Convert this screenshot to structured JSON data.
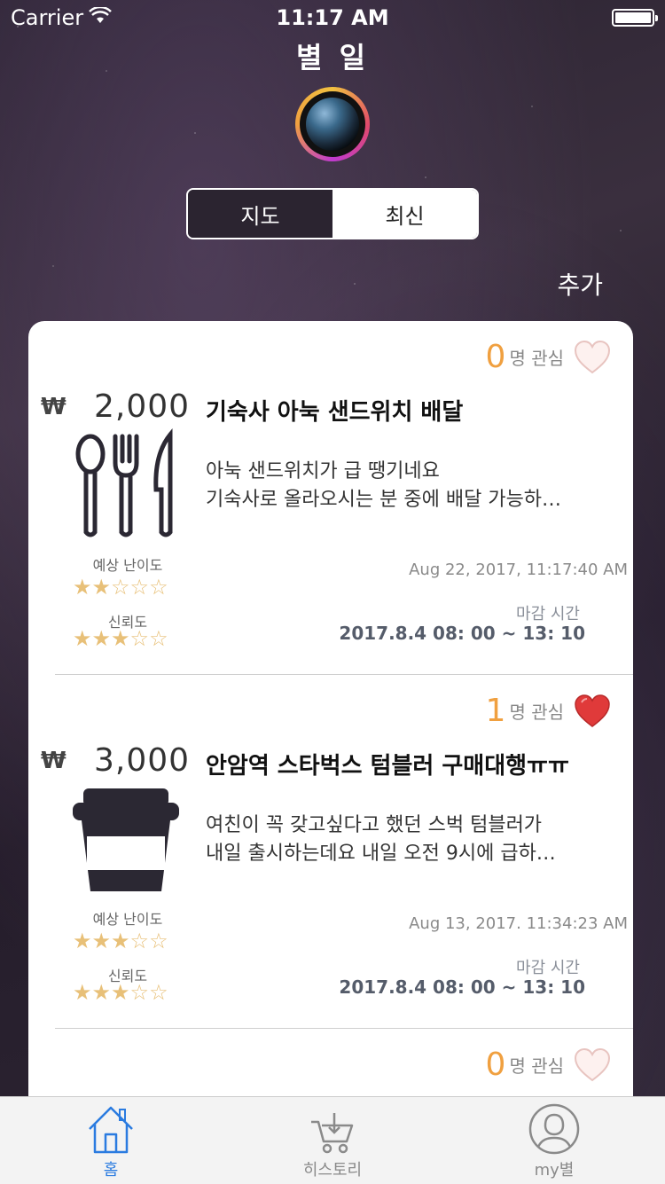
{
  "status": {
    "carrier": "Carrier",
    "time": "11:17 AM"
  },
  "header": {
    "title": "별 일"
  },
  "segment": {
    "map_label": "지도",
    "latest_label": "최신"
  },
  "add_label": "추가",
  "interest_suffix": "명 관심",
  "difficulty_label": "예상 난이도",
  "trust_label": "신뢰도",
  "deadline_label": "마감 시간",
  "items": [
    {
      "interest_count": "0",
      "liked": false,
      "currency": "₩",
      "price": "2,000",
      "title": "기숙사 아눅 샌드위치 배달",
      "desc_line1": "아눅 샌드위치가 급 땡기네요",
      "desc_line2": "기숙사로 올라오시는 분 중에 배달 가능하…",
      "icon": "utensils-icon",
      "difficulty": "★★☆☆☆",
      "trust": "★★★☆☆",
      "date": "Aug 22, 2017, 11:17:40 AM",
      "deadline": "2017.8.4 08: 00 ~  13: 10"
    },
    {
      "interest_count": "1",
      "liked": true,
      "currency": "₩",
      "price": "3,000",
      "title": "안암역 스타벅스 텀블러 구매대행ㅠㅠ",
      "desc_line1": "여친이 꼭 갖고싶다고 했던 스벅 텀블러가",
      "desc_line2": "내일 출시하는데요 내일 오전 9시에 급하…",
      "icon": "coffee-cup-icon",
      "difficulty": "★★★☆☆",
      "trust": "★★★☆☆",
      "date": "Aug 13, 2017. 11:34:23 AM",
      "deadline": "2017.8.4 08: 00 ~  13: 10"
    },
    {
      "interest_count": "0",
      "liked": false
    }
  ],
  "tabs": {
    "home": "홈",
    "history": "히스토리",
    "mystar": "my별"
  },
  "colors": {
    "accent": "#2a7be0",
    "interest": "#f0a040",
    "heart": "#e03a3a",
    "star": "#e8c078"
  }
}
